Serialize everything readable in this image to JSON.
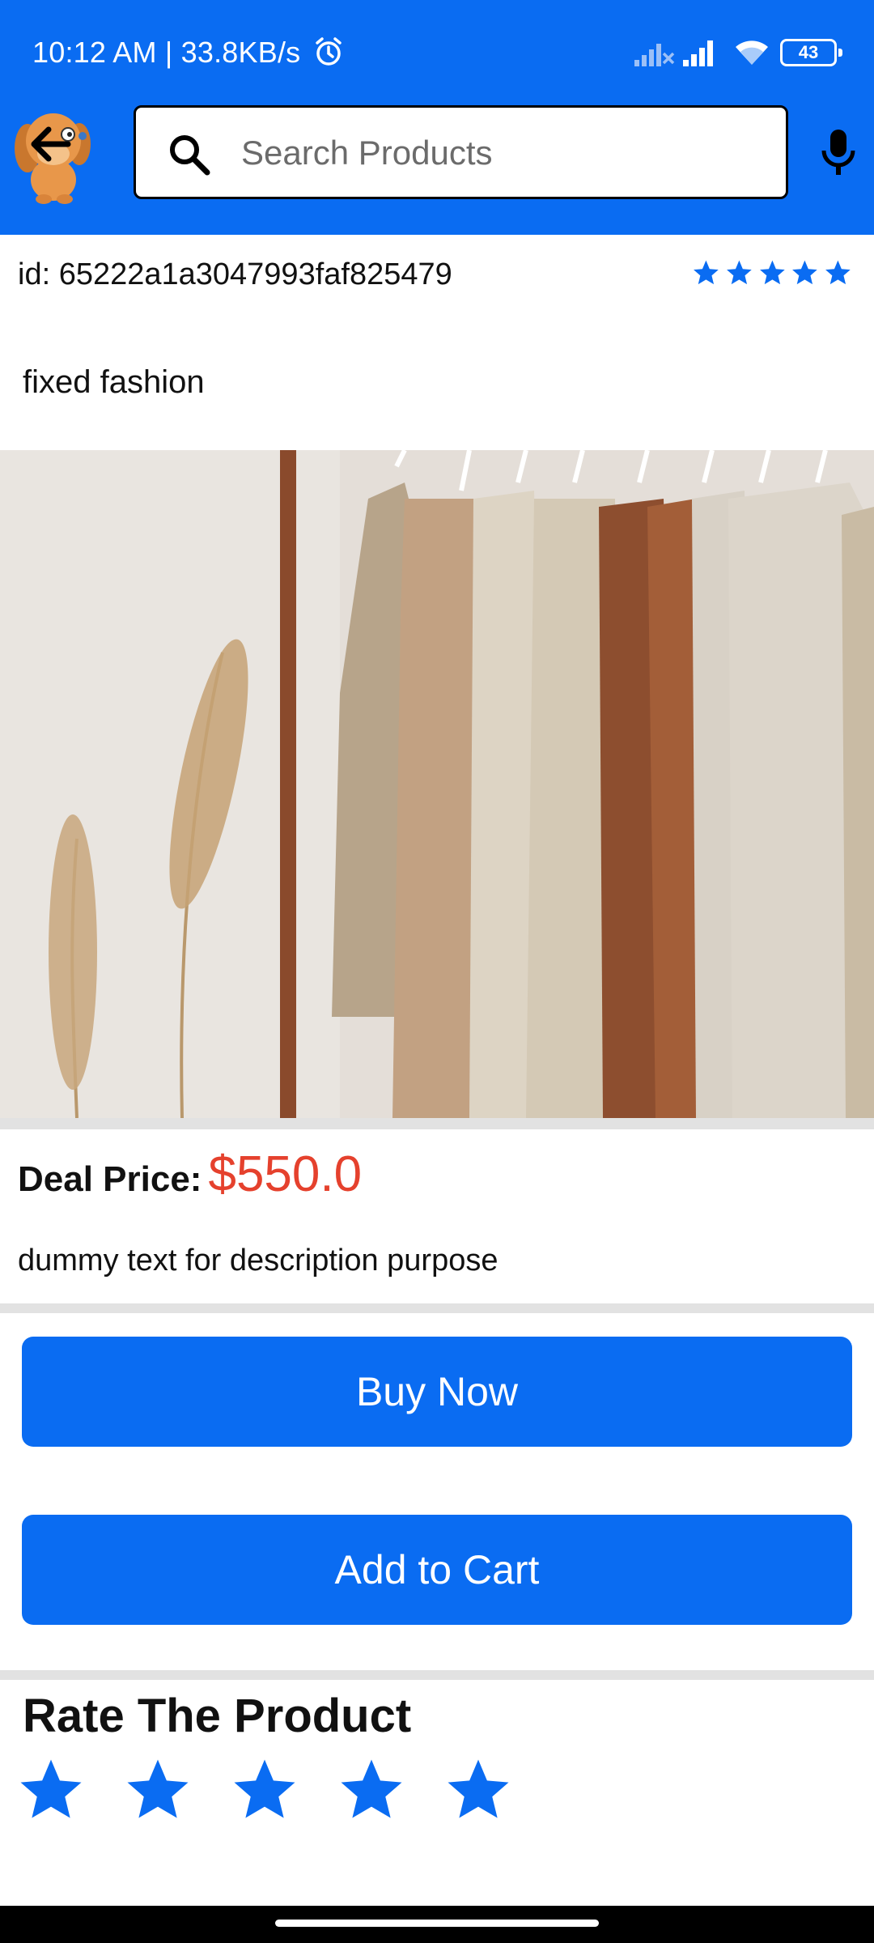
{
  "status_bar": {
    "time": "10:12 AM | 33.8KB/s",
    "battery": "43",
    "icons": [
      "alarm-icon",
      "signal-off-icon",
      "signal-icon",
      "wifi-icon",
      "battery-icon"
    ]
  },
  "header": {
    "back_icon": "arrow-left-icon",
    "logo": "dog-logo",
    "search": {
      "placeholder": "Search Products",
      "value": ""
    },
    "search_icon": "search-icon",
    "mic_icon": "microphone-icon"
  },
  "product": {
    "id_text": "id: 65222a1a3047993faf825479",
    "rating_stars": 5,
    "name": "fixed fashion",
    "image": "clothes-rack-photo",
    "deal_price_label": "Deal Price:",
    "deal_price_value": "$550.0",
    "description": "dummy text for description purpose"
  },
  "actions": {
    "buy_now": "Buy Now",
    "add_to_cart": "Add to Cart"
  },
  "rating": {
    "title": "Rate The Product",
    "stars": 5
  },
  "colors": {
    "brand_blue": "#0a6cf2",
    "price_red": "#e5412d",
    "star_blue": "#0a6cf2",
    "divider": "#e2e2e2"
  }
}
